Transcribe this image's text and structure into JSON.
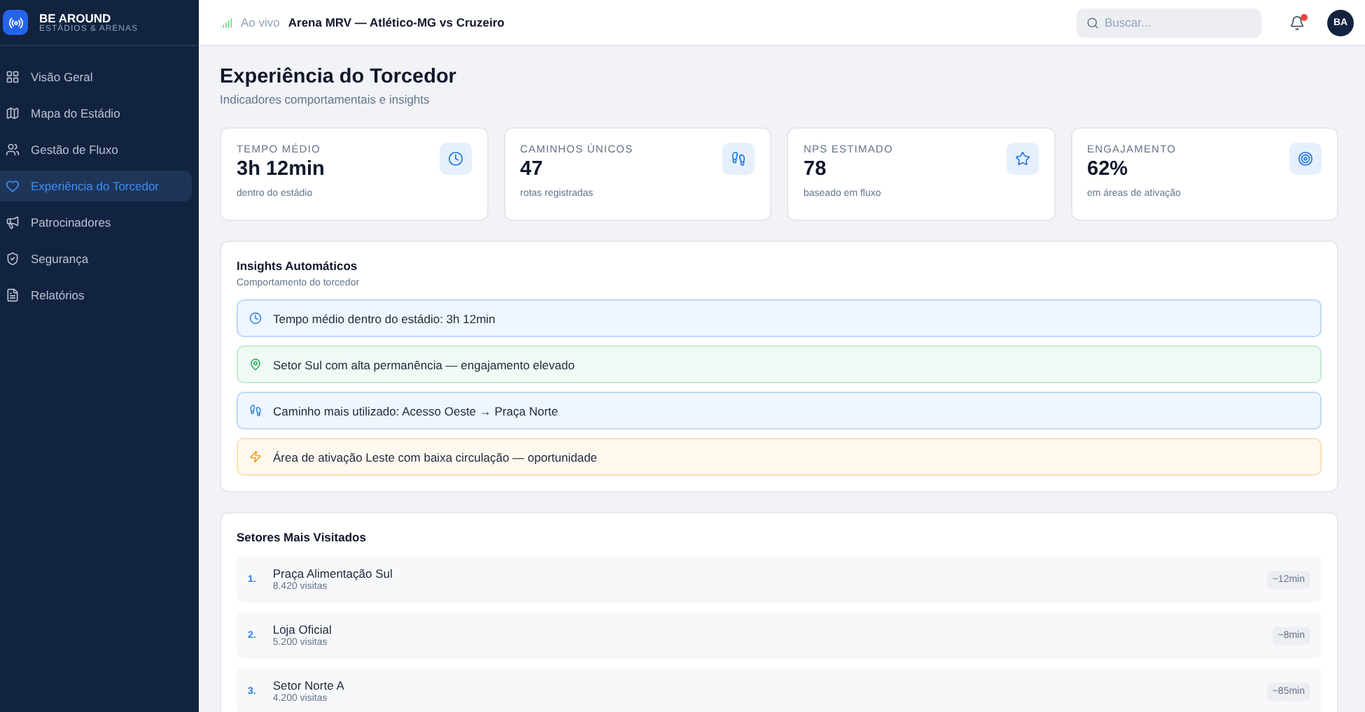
{
  "brand": {
    "name": "BE AROUND",
    "tagline": "ESTÁDIOS & ARENAS"
  },
  "sidebar": {
    "items": [
      {
        "label": "Visão Geral",
        "kind": "grid",
        "selected": false
      },
      {
        "label": "Mapa do Estádio",
        "kind": "map",
        "selected": false
      },
      {
        "label": "Gestão de Fluxo",
        "kind": "users",
        "selected": false
      },
      {
        "label": "Experiência do Torcedor",
        "kind": "heart",
        "selected": true
      },
      {
        "label": "Patrocinadores",
        "kind": "megaphone",
        "selected": false
      },
      {
        "label": "Segurança",
        "kind": "shield",
        "selected": false
      },
      {
        "label": "Relatórios",
        "kind": "file",
        "selected": false
      }
    ]
  },
  "header": {
    "live_label": "Ao vivo",
    "match": "Arena MRV — Atlético-MG vs Cruzeiro",
    "search": {
      "placeholder": "Buscar..."
    },
    "notifications": {
      "unread": true
    },
    "avatar": "BA"
  },
  "page": {
    "title": "Experiência do Torcedor",
    "subtitle": "Indicadores comportamentais e insights"
  },
  "stats": [
    {
      "label": "TEMPO MÉDIO",
      "value": "3h 12min",
      "note": "dentro do estádio",
      "kind": "clock"
    },
    {
      "label": "CAMINHOS ÚNICOS",
      "value": "47",
      "note": "rotas registradas",
      "kind": "footprints"
    },
    {
      "label": "NPS ESTIMADO",
      "value": "78",
      "note": "baseado em fluxo",
      "kind": "star"
    },
    {
      "label": "ENGAJAMENTO",
      "value": "62%",
      "note": "em áreas de ativação",
      "kind": "target"
    }
  ],
  "insights": {
    "title": "Insights Automáticos",
    "subtitle": "Comportamento do torcedor",
    "items": [
      {
        "kind": "time",
        "text": "Tempo médio dentro do estádio: 3h 12min"
      },
      {
        "kind": "location",
        "text": "Setor Sul com alta permanência — engajamento elevado"
      },
      {
        "kind": "path",
        "text": "Caminho mais utilizado: Acesso Oeste → Praça Norte"
      },
      {
        "kind": "opportunity",
        "text": "Área de ativação Leste com baixa circulação — oportunidade"
      }
    ]
  },
  "top_sectors": {
    "title": "Setores Mais Visitados",
    "items": [
      {
        "rank": "1.",
        "name": "Praça Alimentação Sul",
        "visits": "8.420 visitas",
        "duration": "~12min"
      },
      {
        "rank": "2.",
        "name": "Loja Oficial",
        "visits": "5.200 visitas",
        "duration": "~8min"
      },
      {
        "rank": "3.",
        "name": "Setor Norte A",
        "visits": "4.200 visitas",
        "duration": "~85min"
      }
    ]
  }
}
